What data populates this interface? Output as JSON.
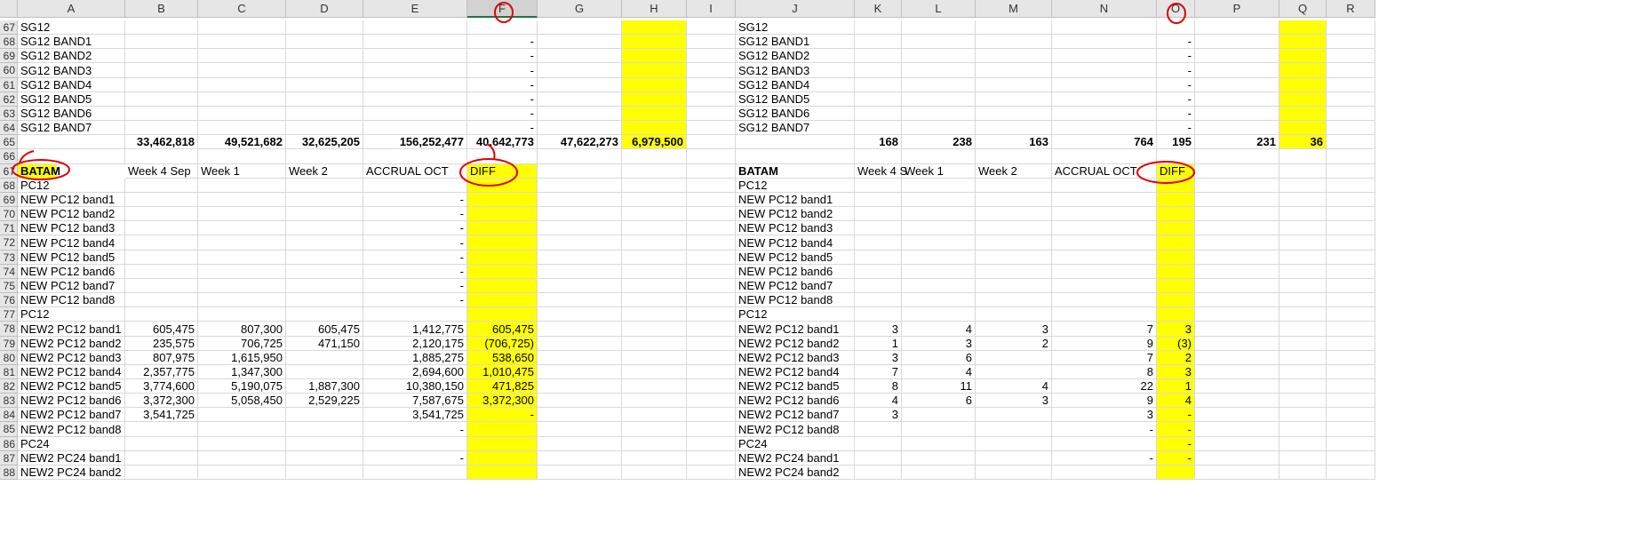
{
  "columns": [
    "A",
    "B",
    "C",
    "D",
    "E",
    "F",
    "G",
    "H",
    "I",
    "J",
    "K",
    "L",
    "M",
    "N",
    "O",
    "P",
    "Q",
    "R"
  ],
  "selected_column": "F",
  "rows": [
    {
      "num": "67",
      "left": [
        "SG12",
        "",
        "",
        "",
        "",
        "",
        "",
        ""
      ],
      "right": [
        "SG12",
        "",
        "",
        "",
        "",
        "",
        "",
        ""
      ]
    },
    {
      "num": "68",
      "left": [
        "SG12 BAND1",
        "",
        "",
        "",
        "",
        "-",
        "",
        ""
      ],
      "right": [
        "SG12 BAND1",
        "",
        "",
        "",
        "",
        "-",
        "",
        ""
      ]
    },
    {
      "num": "69",
      "left": [
        "SG12 BAND2",
        "",
        "",
        "",
        "",
        "-",
        "",
        ""
      ],
      "right": [
        "SG12 BAND2",
        "",
        "",
        "",
        "",
        "-",
        "",
        ""
      ]
    },
    {
      "num": "60",
      "left": [
        "SG12 BAND3",
        "",
        "",
        "",
        "",
        "-",
        "",
        ""
      ],
      "right": [
        "SG12 BAND3",
        "",
        "",
        "",
        "",
        "-",
        "",
        ""
      ]
    },
    {
      "num": "61",
      "left": [
        "SG12 BAND4",
        "",
        "",
        "",
        "",
        "-",
        "",
        ""
      ],
      "right": [
        "SG12 BAND4",
        "",
        "",
        "",
        "",
        "-",
        "",
        ""
      ]
    },
    {
      "num": "62",
      "left": [
        "SG12 BAND5",
        "",
        "",
        "",
        "",
        "-",
        "",
        ""
      ],
      "right": [
        "SG12 BAND5",
        "",
        "",
        "",
        "",
        "-",
        "",
        ""
      ]
    },
    {
      "num": "63",
      "left": [
        "SG12 BAND6",
        "",
        "",
        "",
        "",
        "-",
        "",
        ""
      ],
      "right": [
        "SG12 BAND6",
        "",
        "",
        "",
        "",
        "-",
        "",
        ""
      ]
    },
    {
      "num": "64",
      "left": [
        "SG12 BAND7",
        "",
        "",
        "",
        "",
        "-",
        "",
        ""
      ],
      "right": [
        "SG12 BAND7",
        "",
        "",
        "",
        "",
        "-",
        "",
        ""
      ]
    },
    {
      "num": "65",
      "left": [
        "",
        "33,462,818",
        "49,521,682",
        "32,625,205",
        "156,252,477",
        "40,642,773",
        "47,622,273",
        "6,979,500"
      ],
      "right": [
        "",
        "168",
        "238",
        "163",
        "764",
        "195",
        "231",
        "36"
      ]
    },
    {
      "num": "66",
      "left": [
        "",
        "",
        "",
        "",
        "",
        "",
        "",
        ""
      ],
      "right": [
        "",
        "",
        "",
        "",
        "",
        "",
        "",
        ""
      ]
    },
    {
      "num": "67",
      "left": [
        "BATAM",
        "Week 4 Sep",
        "Week 1",
        "Week 2",
        "ACCRUAL OCT",
        "DIFF",
        "",
        ""
      ],
      "right": [
        "BATAM",
        "Week 4 S",
        "Week 1",
        "Week 2",
        "ACCRUAL OCT",
        "DIFF",
        "",
        ""
      ]
    },
    {
      "num": "68",
      "left": [
        "PC12",
        "",
        "",
        "",
        "",
        "",
        "",
        ""
      ],
      "right": [
        "PC12",
        "",
        "",
        "",
        "",
        "",
        "",
        ""
      ]
    },
    {
      "num": "69",
      "left": [
        "NEW PC12 band1",
        "",
        "",
        "",
        "-",
        "",
        "",
        ""
      ],
      "right": [
        "NEW PC12 band1",
        "",
        "",
        "",
        "",
        "",
        "",
        ""
      ]
    },
    {
      "num": "70",
      "left": [
        "NEW PC12 band2",
        "",
        "",
        "",
        "-",
        "",
        "",
        ""
      ],
      "right": [
        "NEW PC12 band2",
        "",
        "",
        "",
        "",
        "",
        "",
        ""
      ]
    },
    {
      "num": "71",
      "left": [
        "NEW PC12 band3",
        "",
        "",
        "",
        "-",
        "",
        "",
        ""
      ],
      "right": [
        "NEW PC12 band3",
        "",
        "",
        "",
        "",
        "",
        "",
        ""
      ]
    },
    {
      "num": "72",
      "left": [
        "NEW PC12 band4",
        "",
        "",
        "",
        "-",
        "",
        "",
        ""
      ],
      "right": [
        "NEW PC12 band4",
        "",
        "",
        "",
        "",
        "",
        "",
        ""
      ]
    },
    {
      "num": "73",
      "left": [
        "NEW PC12 band5",
        "",
        "",
        "",
        "-",
        "",
        "",
        ""
      ],
      "right": [
        "NEW PC12 band5",
        "",
        "",
        "",
        "",
        "",
        "",
        ""
      ]
    },
    {
      "num": "74",
      "left": [
        "NEW PC12 band6",
        "",
        "",
        "",
        "-",
        "",
        "",
        ""
      ],
      "right": [
        "NEW PC12 band6",
        "",
        "",
        "",
        "",
        "",
        "",
        ""
      ]
    },
    {
      "num": "75",
      "left": [
        "NEW PC12 band7",
        "",
        "",
        "",
        "-",
        "",
        "",
        ""
      ],
      "right": [
        "NEW PC12 band7",
        "",
        "",
        "",
        "",
        "",
        "",
        ""
      ]
    },
    {
      "num": "76",
      "left": [
        "NEW PC12 band8",
        "",
        "",
        "",
        "-",
        "",
        "",
        ""
      ],
      "right": [
        "NEW PC12 band8",
        "",
        "",
        "",
        "",
        "",
        "",
        ""
      ]
    },
    {
      "num": "77",
      "left": [
        "PC12",
        "",
        "",
        "",
        "",
        "",
        "",
        ""
      ],
      "right": [
        "PC12",
        "",
        "",
        "",
        "",
        "",
        "",
        ""
      ]
    },
    {
      "num": "78",
      "left": [
        "NEW2 PC12 band1",
        "605,475",
        "807,300",
        "605,475",
        "1,412,775",
        "605,475",
        "",
        ""
      ],
      "right": [
        "NEW2 PC12 band1",
        "3",
        "4",
        "3",
        "7",
        "3",
        "",
        ""
      ]
    },
    {
      "num": "79",
      "left": [
        "NEW2 PC12 band2",
        "235,575",
        "706,725",
        "471,150",
        "2,120,175",
        "(706,725)",
        "",
        ""
      ],
      "right": [
        "NEW2 PC12 band2",
        "1",
        "3",
        "2",
        "9",
        "(3)",
        "",
        ""
      ]
    },
    {
      "num": "80",
      "left": [
        "NEW2 PC12 band3",
        "807,975",
        "1,615,950",
        "",
        "1,885,275",
        "538,650",
        "",
        ""
      ],
      "right": [
        "NEW2 PC12 band3",
        "3",
        "6",
        "",
        "7",
        "2",
        "",
        ""
      ]
    },
    {
      "num": "81",
      "left": [
        "NEW2 PC12 band4",
        "2,357,775",
        "1,347,300",
        "",
        "2,694,600",
        "1,010,475",
        "",
        ""
      ],
      "right": [
        "NEW2 PC12 band4",
        "7",
        "4",
        "",
        "8",
        "3",
        "",
        ""
      ]
    },
    {
      "num": "82",
      "left": [
        "NEW2 PC12 band5",
        "3,774,600",
        "5,190,075",
        "1,887,300",
        "10,380,150",
        "471,825",
        "",
        ""
      ],
      "right": [
        "NEW2 PC12 band5",
        "8",
        "11",
        "4",
        "22",
        "1",
        "",
        ""
      ]
    },
    {
      "num": "83",
      "left": [
        "NEW2 PC12 band6",
        "3,372,300",
        "5,058,450",
        "2,529,225",
        "7,587,675",
        "3,372,300",
        "",
        ""
      ],
      "right": [
        "NEW2 PC12 band6",
        "4",
        "6",
        "3",
        "9",
        "4",
        "",
        ""
      ]
    },
    {
      "num": "84",
      "left": [
        "NEW2 PC12 band7",
        "3,541,725",
        "",
        "",
        "3,541,725",
        "-",
        "",
        ""
      ],
      "right": [
        "NEW2 PC12 band7",
        "3",
        "",
        "",
        "3",
        "-",
        "",
        ""
      ]
    },
    {
      "num": "85",
      "left": [
        "NEW2 PC12 band8",
        "",
        "",
        "",
        "-",
        "",
        "",
        ""
      ],
      "right": [
        "NEW2 PC12 band8",
        "",
        "",
        "",
        "-",
        "-",
        "",
        ""
      ]
    },
    {
      "num": "86",
      "left": [
        "PC24",
        "",
        "",
        "",
        "",
        "",
        "",
        ""
      ],
      "right": [
        "PC24",
        "",
        "",
        "",
        "",
        "-",
        "",
        ""
      ]
    },
    {
      "num": "87",
      "left": [
        "NEW2 PC24 band1",
        "",
        "",
        "",
        "-",
        "",
        "",
        ""
      ],
      "right": [
        "NEW2 PC24 band1",
        "",
        "",
        "",
        "-",
        "-",
        "",
        ""
      ]
    },
    {
      "num": "88",
      "left": [
        "NEW2 PC24 band2",
        "",
        "",
        "",
        "",
        "",
        "",
        ""
      ],
      "right": [
        "NEW2 PC24 band2",
        "",
        "",
        "",
        "",
        "",
        "",
        ""
      ]
    }
  ],
  "colors": {
    "highlight": "#ffff00",
    "annotation": "#e00000",
    "selected_header": "#217346"
  }
}
